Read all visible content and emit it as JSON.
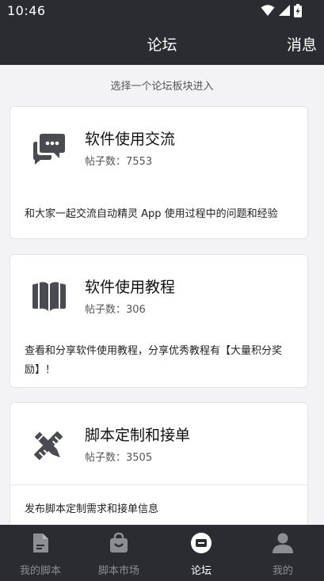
{
  "status_bar": {
    "time": "10:46"
  },
  "header": {
    "title": "论坛",
    "messages_label": "消息"
  },
  "subtitle": "选择一个论坛板块进入",
  "boards": [
    {
      "icon": "chat-bubbles-icon",
      "title": "软件使用交流",
      "count": "帖子数：7553",
      "description": "和大家一起交流自动精灵 App 使用过程中的问题和经验"
    },
    {
      "icon": "open-book-icon",
      "title": "软件使用教程",
      "count": "帖子数：306",
      "description": "查看和分享软件使用教程，分享优秀教程有【大量积分奖励】！"
    },
    {
      "icon": "pencil-ruler-icon",
      "title": "脚本定制和接单",
      "count": "帖子数：3505",
      "description": "发布脚本定制需求和接单信息"
    }
  ],
  "tabs": [
    {
      "icon": "document-icon",
      "label": "我的脚本"
    },
    {
      "icon": "shopping-bag-icon",
      "label": "脚本市场"
    },
    {
      "icon": "forum-icon",
      "label": "论坛"
    },
    {
      "icon": "person-icon",
      "label": "我的"
    }
  ],
  "colors": {
    "bar_background": "#2b2c31",
    "page_background": "#f3f3f6",
    "inactive_tab": "#8d8e93",
    "icon_gray": "#4a4b50"
  }
}
